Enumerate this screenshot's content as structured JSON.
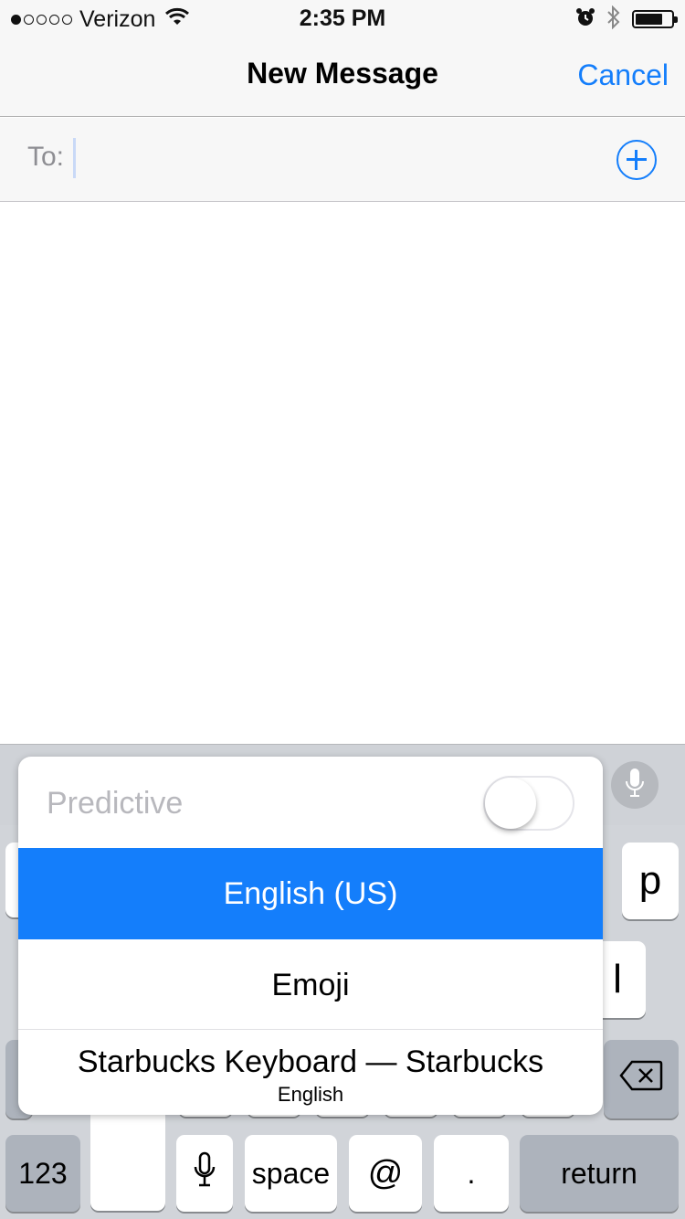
{
  "status_bar": {
    "carrier": "Verizon",
    "time": "2:35 PM",
    "signal_bars_filled": 1,
    "signal_bars_total": 5,
    "battery_level_percent": 75
  },
  "nav": {
    "title": "New Message",
    "cancel_label": "Cancel"
  },
  "recipient": {
    "label": "To:",
    "value": ""
  },
  "keyboard": {
    "key_p": "p",
    "key_l": "l",
    "key_123": "123",
    "key_space": "space",
    "key_at": "@",
    "key_period": ".",
    "key_return": "return"
  },
  "language_menu": {
    "predictive_label": "Predictive",
    "predictive_enabled": false,
    "options": [
      {
        "label": "English (US)",
        "selected": true
      },
      {
        "label": "Emoji",
        "selected": false
      },
      {
        "label": "Starbucks Keyboard — Starbucks",
        "caption": "English",
        "selected": false
      }
    ]
  },
  "colors": {
    "accent": "#147efb",
    "bar_background": "#f7f7f7",
    "keyboard_background": "#d1d4d9"
  },
  "icons": [
    "wifi-icon",
    "alarm-icon",
    "bluetooth-icon",
    "battery-icon",
    "add-contact-icon",
    "microphone-icon",
    "delete-icon"
  ]
}
